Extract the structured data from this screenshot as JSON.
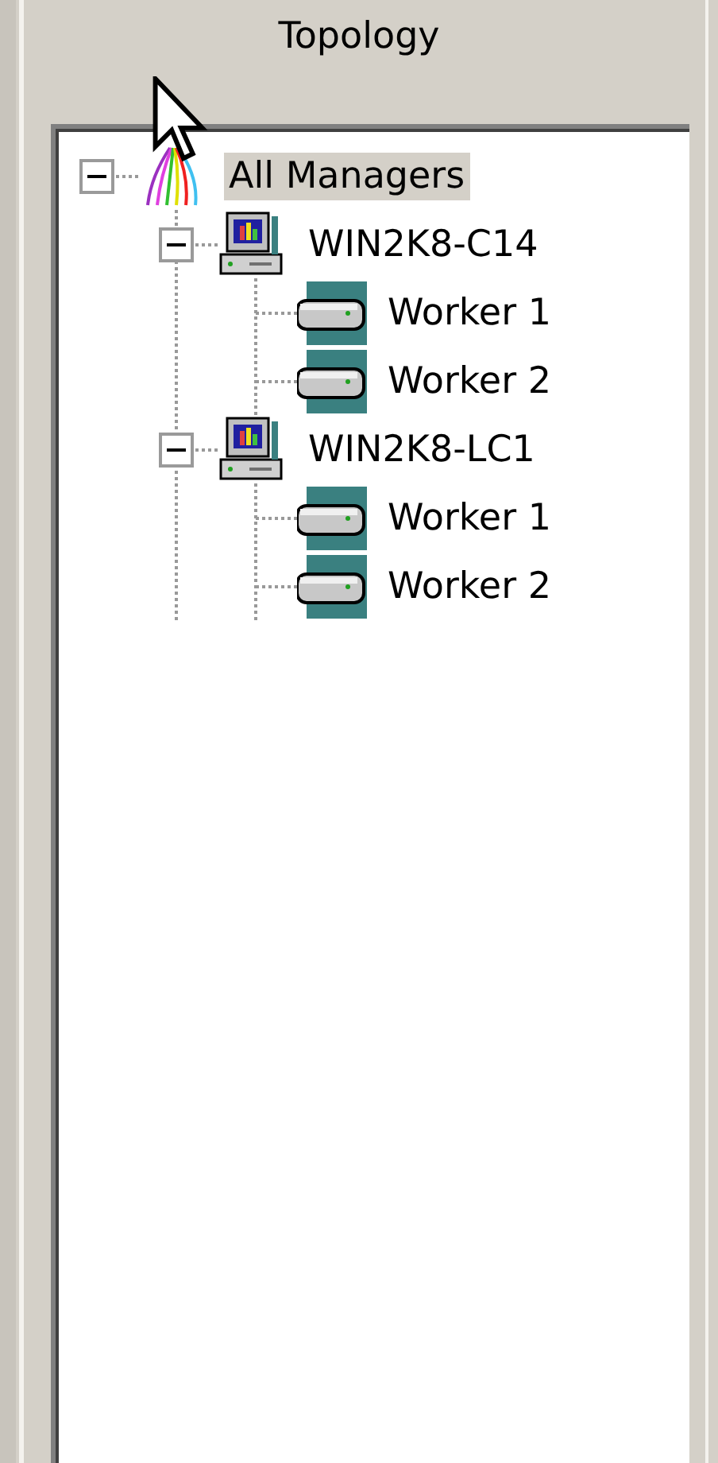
{
  "panel": {
    "title": "Topology"
  },
  "tree": [
    {
      "label": "All Managers",
      "kind": "managers",
      "selected": true,
      "expanded": true,
      "children": [
        {
          "label": "WIN2K8-C14",
          "kind": "computer",
          "selected": false,
          "expanded": true,
          "children": [
            {
              "label": "Worker 1",
              "kind": "worker",
              "selected": false
            },
            {
              "label": "Worker 2",
              "kind": "worker",
              "selected": false
            }
          ]
        },
        {
          "label": "WIN2K8-LC1",
          "kind": "computer",
          "selected": false,
          "expanded": true,
          "children": [
            {
              "label": "Worker 1",
              "kind": "worker",
              "selected": false
            },
            {
              "label": "Worker 2",
              "kind": "worker",
              "selected": false
            }
          ]
        }
      ]
    }
  ]
}
